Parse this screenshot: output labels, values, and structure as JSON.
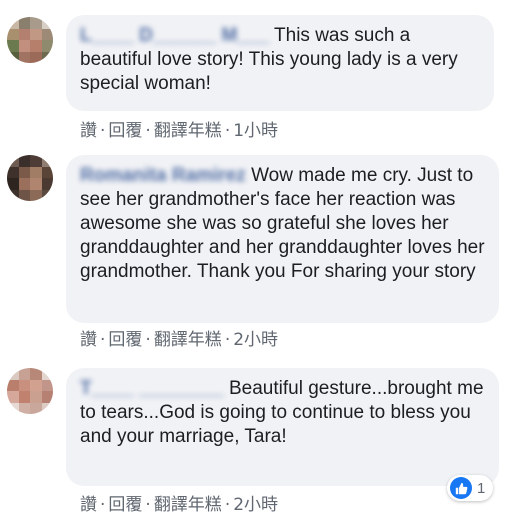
{
  "comments": [
    {
      "author": "L____ D______ M___",
      "text": "This was such a beautiful love story! This young lady is a very special woman!",
      "actions": {
        "like": "讚",
        "reply": "回覆",
        "translate": "翻譯年糕",
        "time": "1小時"
      }
    },
    {
      "author": "Romanita Ramirez",
      "text": "Wow made me cry. Just to see her grandmother's face her reaction was awesome she was so grateful she loves her granddaughter and her granddaughter loves her grandmother. Thank you For sharing your story",
      "actions": {
        "like": "讚",
        "reply": "回覆",
        "translate": "翻譯年糕",
        "time": "2小時"
      }
    },
    {
      "author": "T____ ________",
      "text": "Beautiful gesture...brought me to tears...God is going to continue to bless you and your marriage, Tara!",
      "actions": {
        "like": "讚",
        "reply": "回覆",
        "translate": "翻譯年糕",
        "time": "2小時"
      },
      "reaction_count": "1"
    }
  ],
  "separator": "·",
  "colors": {
    "accent": "#1877f2",
    "bubble": "#f0f2f5",
    "name": "#385898",
    "meta": "#606770"
  },
  "icons": {
    "reaction": "like-icon"
  }
}
